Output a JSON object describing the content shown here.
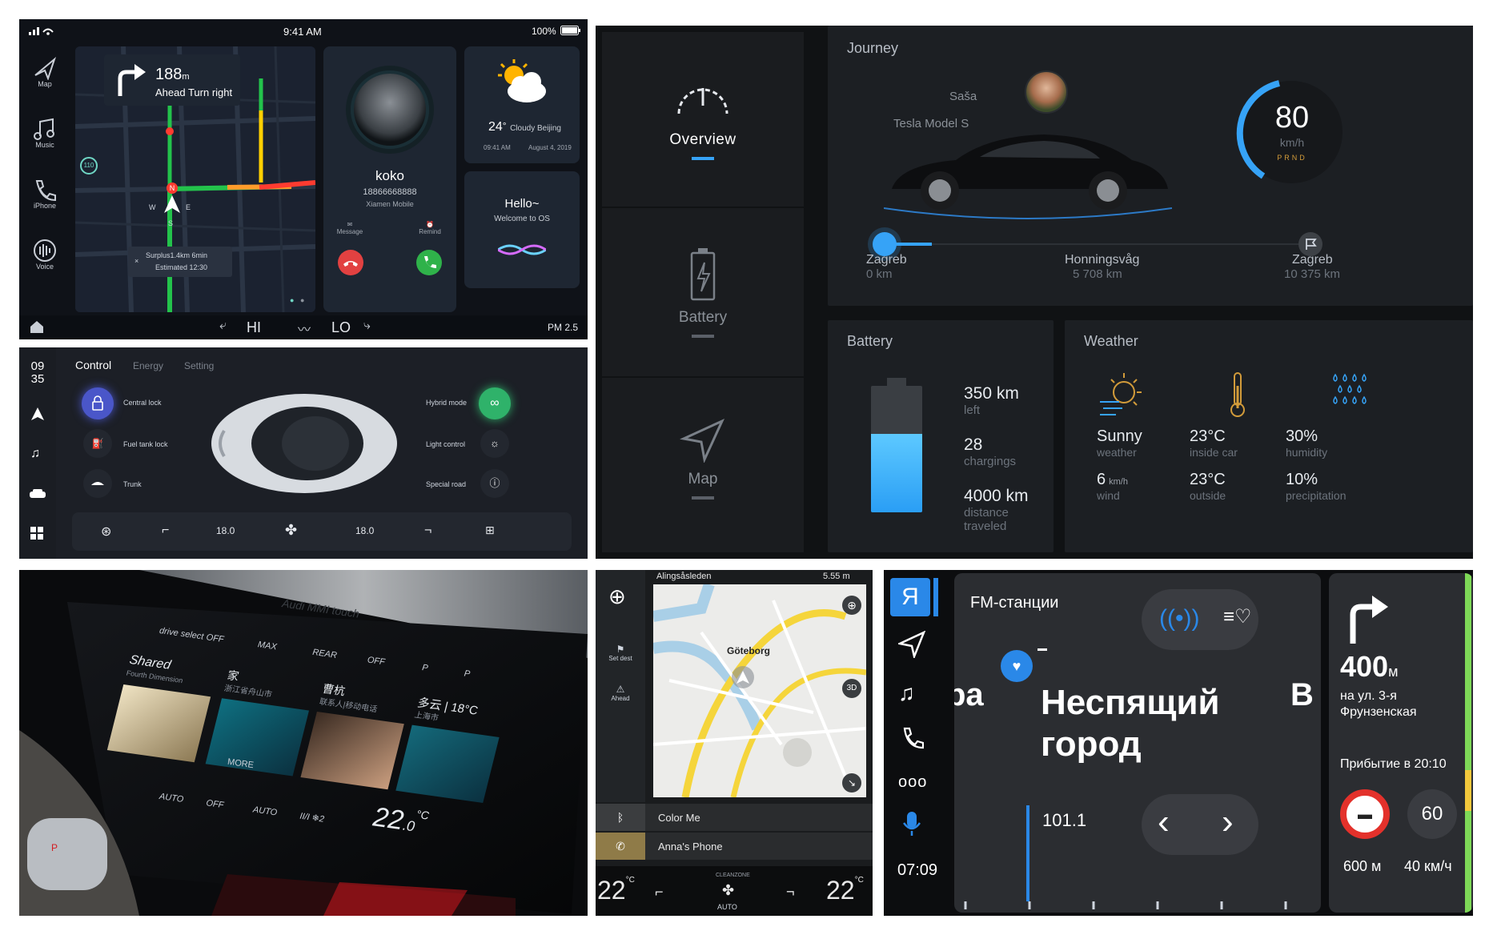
{
  "p1": {
    "status": {
      "time": "9:41 AM",
      "battery": "100%"
    },
    "sidebar": [
      {
        "label": "Map",
        "icon": "navigation-arrow-icon"
      },
      {
        "label": "Music",
        "icon": "music-note-icon"
      },
      {
        "label": "iPhone",
        "icon": "phone-icon"
      },
      {
        "label": "Voice",
        "icon": "voice-icon"
      }
    ],
    "nav": {
      "distance": "188",
      "unit": "m",
      "instruction": "Ahead Turn right",
      "speed_sign": "110"
    },
    "compass": {
      "n": "N",
      "w": "W",
      "e": "E",
      "s": "S"
    },
    "trip": {
      "surplus": "Surplus1.4km 6min",
      "estimated": "Estimated 12:30"
    },
    "contact": {
      "name": "koko",
      "number": "18866668888",
      "carrier": "Xiamen Mobile",
      "message_label": "Message",
      "remind_label": "Remind"
    },
    "weather": {
      "temp": "24",
      "degree": "°",
      "desc": "Cloudy Beijing",
      "time": "09:41 AM",
      "date": "August 4, 2019"
    },
    "hello": {
      "title": "Hello~",
      "subtitle": "Welcome to OS"
    },
    "bottom": {
      "hi": "HI",
      "lo": "LO",
      "clock": "PM 2.5"
    }
  },
  "p2": {
    "nav": [
      {
        "label": "Overview",
        "active": true
      },
      {
        "label": "Battery",
        "active": false
      },
      {
        "label": "Map",
        "active": false
      }
    ],
    "journey": {
      "title": "Journey",
      "driver": "Saša",
      "car": "Tesla Model S",
      "speed": "80",
      "speed_unit": "km/h",
      "gears": "PRND",
      "stops": [
        {
          "name": "Zagreb",
          "dist": "0 km"
        },
        {
          "name": "Honningsvåg",
          "dist": "5 708 km"
        },
        {
          "name": "Zagreb",
          "dist": "10 375 km"
        }
      ]
    },
    "battery": {
      "title": "Battery",
      "items": [
        {
          "value": "350 km",
          "label": "left"
        },
        {
          "value": "28",
          "label": "chargings"
        },
        {
          "value": "4000 km",
          "label": "distance traveled"
        }
      ],
      "level": 0.62
    },
    "weather": {
      "title": "Weather",
      "cells": [
        {
          "value": "Sunny",
          "unit": "",
          "label": "weather"
        },
        {
          "value": "23°C",
          "unit": "",
          "label": "inside car"
        },
        {
          "value": "30%",
          "unit": "",
          "label": "humidity"
        },
        {
          "value": "6",
          "unit": "km/h",
          "label": "wind"
        },
        {
          "value": "23°C",
          "unit": "",
          "label": "outside"
        },
        {
          "value": "10%",
          "unit": "",
          "label": "precipitation"
        }
      ]
    }
  },
  "p3": {
    "time": {
      "hour": "09",
      "minute": "35"
    },
    "tabs": [
      "Control",
      "Energy",
      "Setting"
    ],
    "left_controls": [
      "Central lock",
      "Fuel tank lock",
      "Trunk"
    ],
    "right_controls": [
      "Hybrid mode",
      "Light control",
      "Special road"
    ],
    "temps": [
      "18.0",
      "18.0"
    ]
  },
  "p4": {
    "brand": "Audi MMI touch",
    "top_row": [
      "drive select",
      "OFF",
      "MAX",
      "REAR",
      "OFF",
      "P",
      "P"
    ],
    "tiles": [
      {
        "title": "Shared",
        "sub": "Fourth Dimension"
      },
      {
        "title": "家",
        "sub": "浙江省舟山市"
      },
      {
        "title": "曹杭",
        "sub": "联系人|移动电话"
      },
      {
        "title": "多云 | 18°C",
        "sub": "上海市"
      }
    ],
    "more": "MORE",
    "bottom_row": [
      "AUTO",
      "OFF",
      "AUTO",
      "II/I ❄2"
    ],
    "temp": "22",
    "temp_decimal": ".0",
    "temp_unit": "°C",
    "fan": "❄2",
    "gear_p": "P"
  },
  "p5": {
    "header": {
      "street": "Alingsåsleden",
      "distance": "5.55 m"
    },
    "left_items": [
      "Set dest",
      "Ahead"
    ],
    "map": {
      "city": "Göteborg",
      "mode_label": "3D"
    },
    "media": [
      {
        "title": "Color Me",
        "icon": "bluetooth-icon"
      },
      {
        "title": "Anna's Phone",
        "icon": "phone-icon"
      }
    ],
    "climate": {
      "left_temp": "22",
      "right_temp": "22",
      "unit": "°C",
      "mode": "AUTO",
      "zone": "CLEANZONE"
    }
  },
  "p6": {
    "clock": "07:09",
    "logo": "Я",
    "station_header": "FM-станции",
    "station_name_line1": "Неспящий",
    "station_name_line2": "город",
    "frequency": "101.1",
    "edge_left": "ра",
    "edge_right": "В",
    "nav": {
      "distance": "400",
      "unit": "м",
      "street_line1": "на ул. 3-я",
      "street_line2": "Фрунзенская",
      "arrival": "Прибытие в 20:10",
      "sign_distance": "600 м",
      "speed_limit": "60",
      "speed_unit": "40 км/ч"
    }
  }
}
